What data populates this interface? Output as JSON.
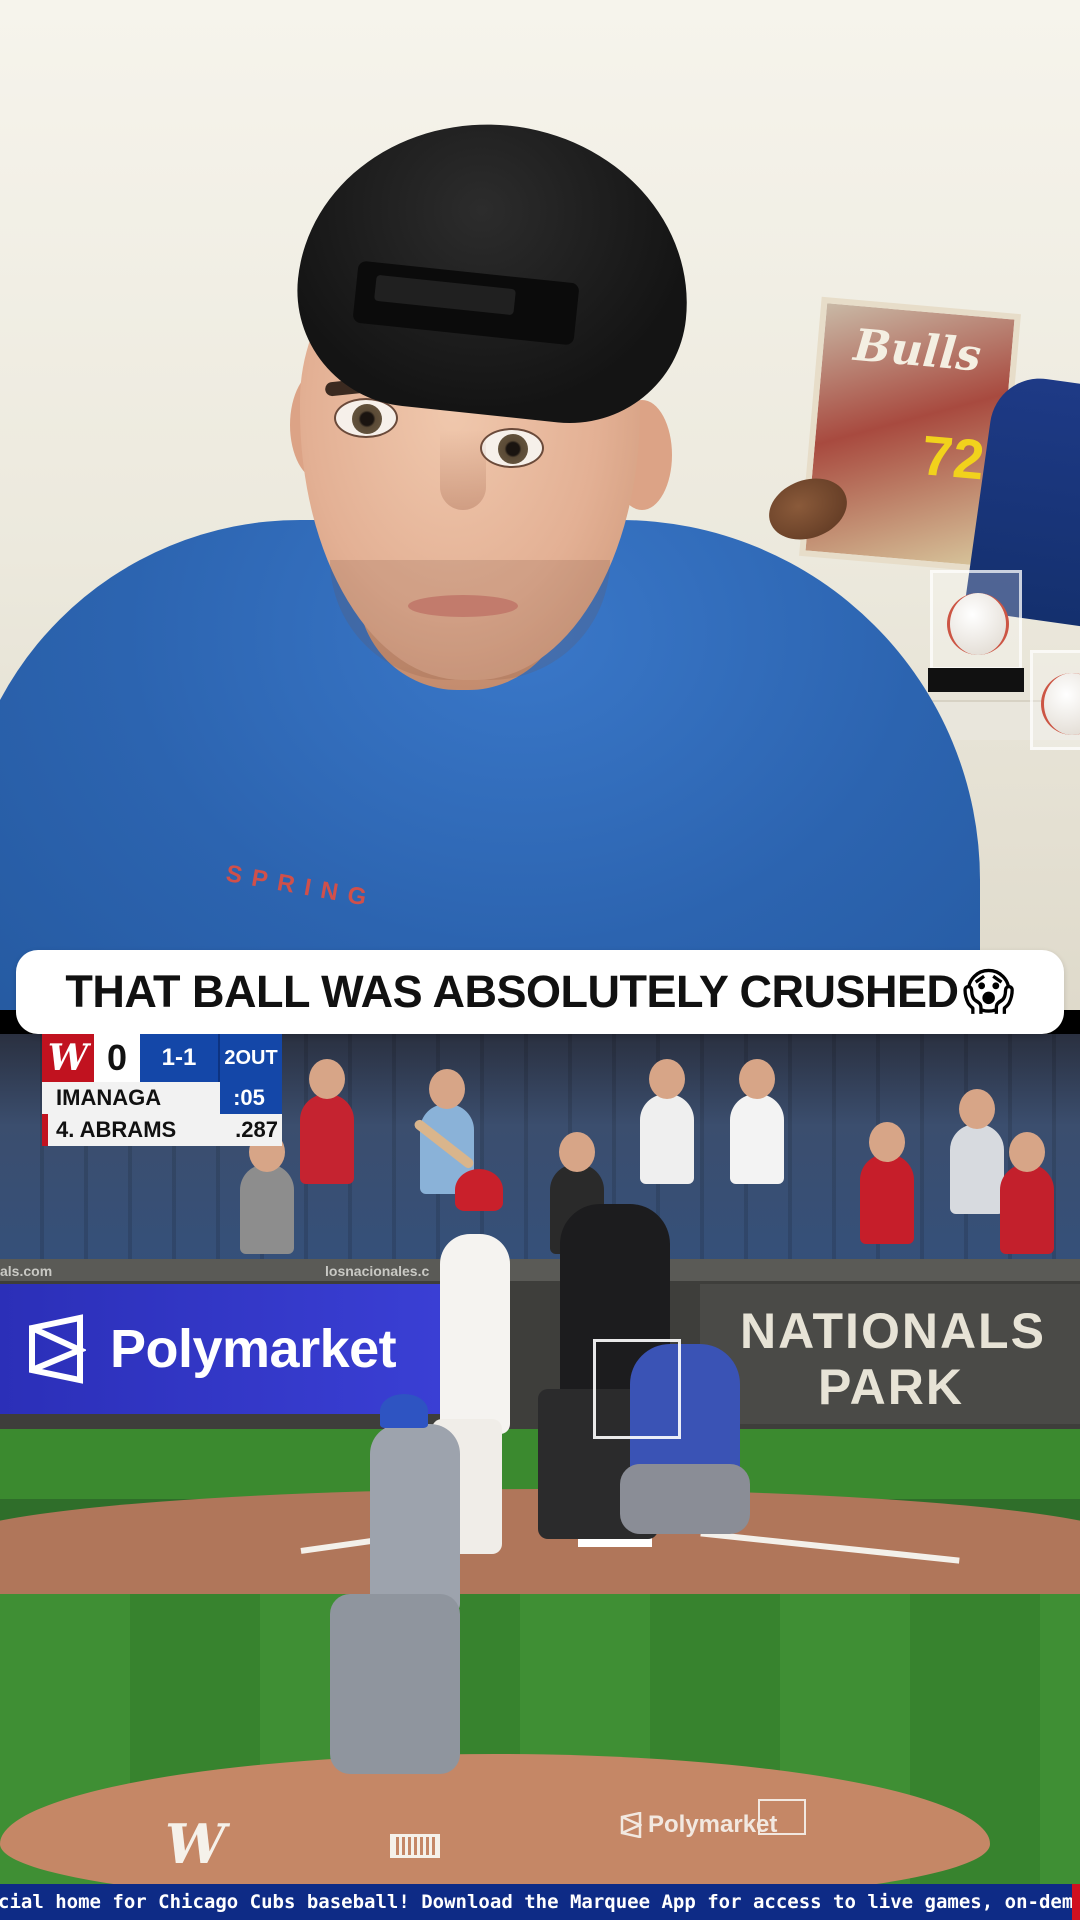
{
  "caption": {
    "text": "THAT BALL WAS ABSOLUTELY CRUSHED",
    "emoji": "😱"
  },
  "background": {
    "poster_title": "Bulls",
    "poster_number": "72",
    "shirt_print": "SPRING"
  },
  "scorebug": {
    "team_logo": "W",
    "score": "0",
    "count": "1-1",
    "outs": "2OUT",
    "pitcher_name": "IMANAGA",
    "pitch_clock": ":05",
    "batter_name": "4. ABRAMS",
    "batter_avg": ".287"
  },
  "stadium": {
    "wall_text_left": "als.com",
    "wall_text_mid": "losnacionales.c",
    "ad_sponsor": "Polymarket",
    "park_sign_line1": "NATIONALS",
    "park_sign_line2": "PARK",
    "mound_logo": "W",
    "mound_sponsor": "Polymarket"
  },
  "ticker": {
    "text": "cial home for Chicago Cubs baseball!  Download the Marquee App for access to live games, on-demai"
  },
  "colors": {
    "ad_blue": "#3a3fd4",
    "scorebug_blue": "#1447a8",
    "nationals_red": "#c1121f",
    "ticker_blue": "#0e2b86"
  }
}
